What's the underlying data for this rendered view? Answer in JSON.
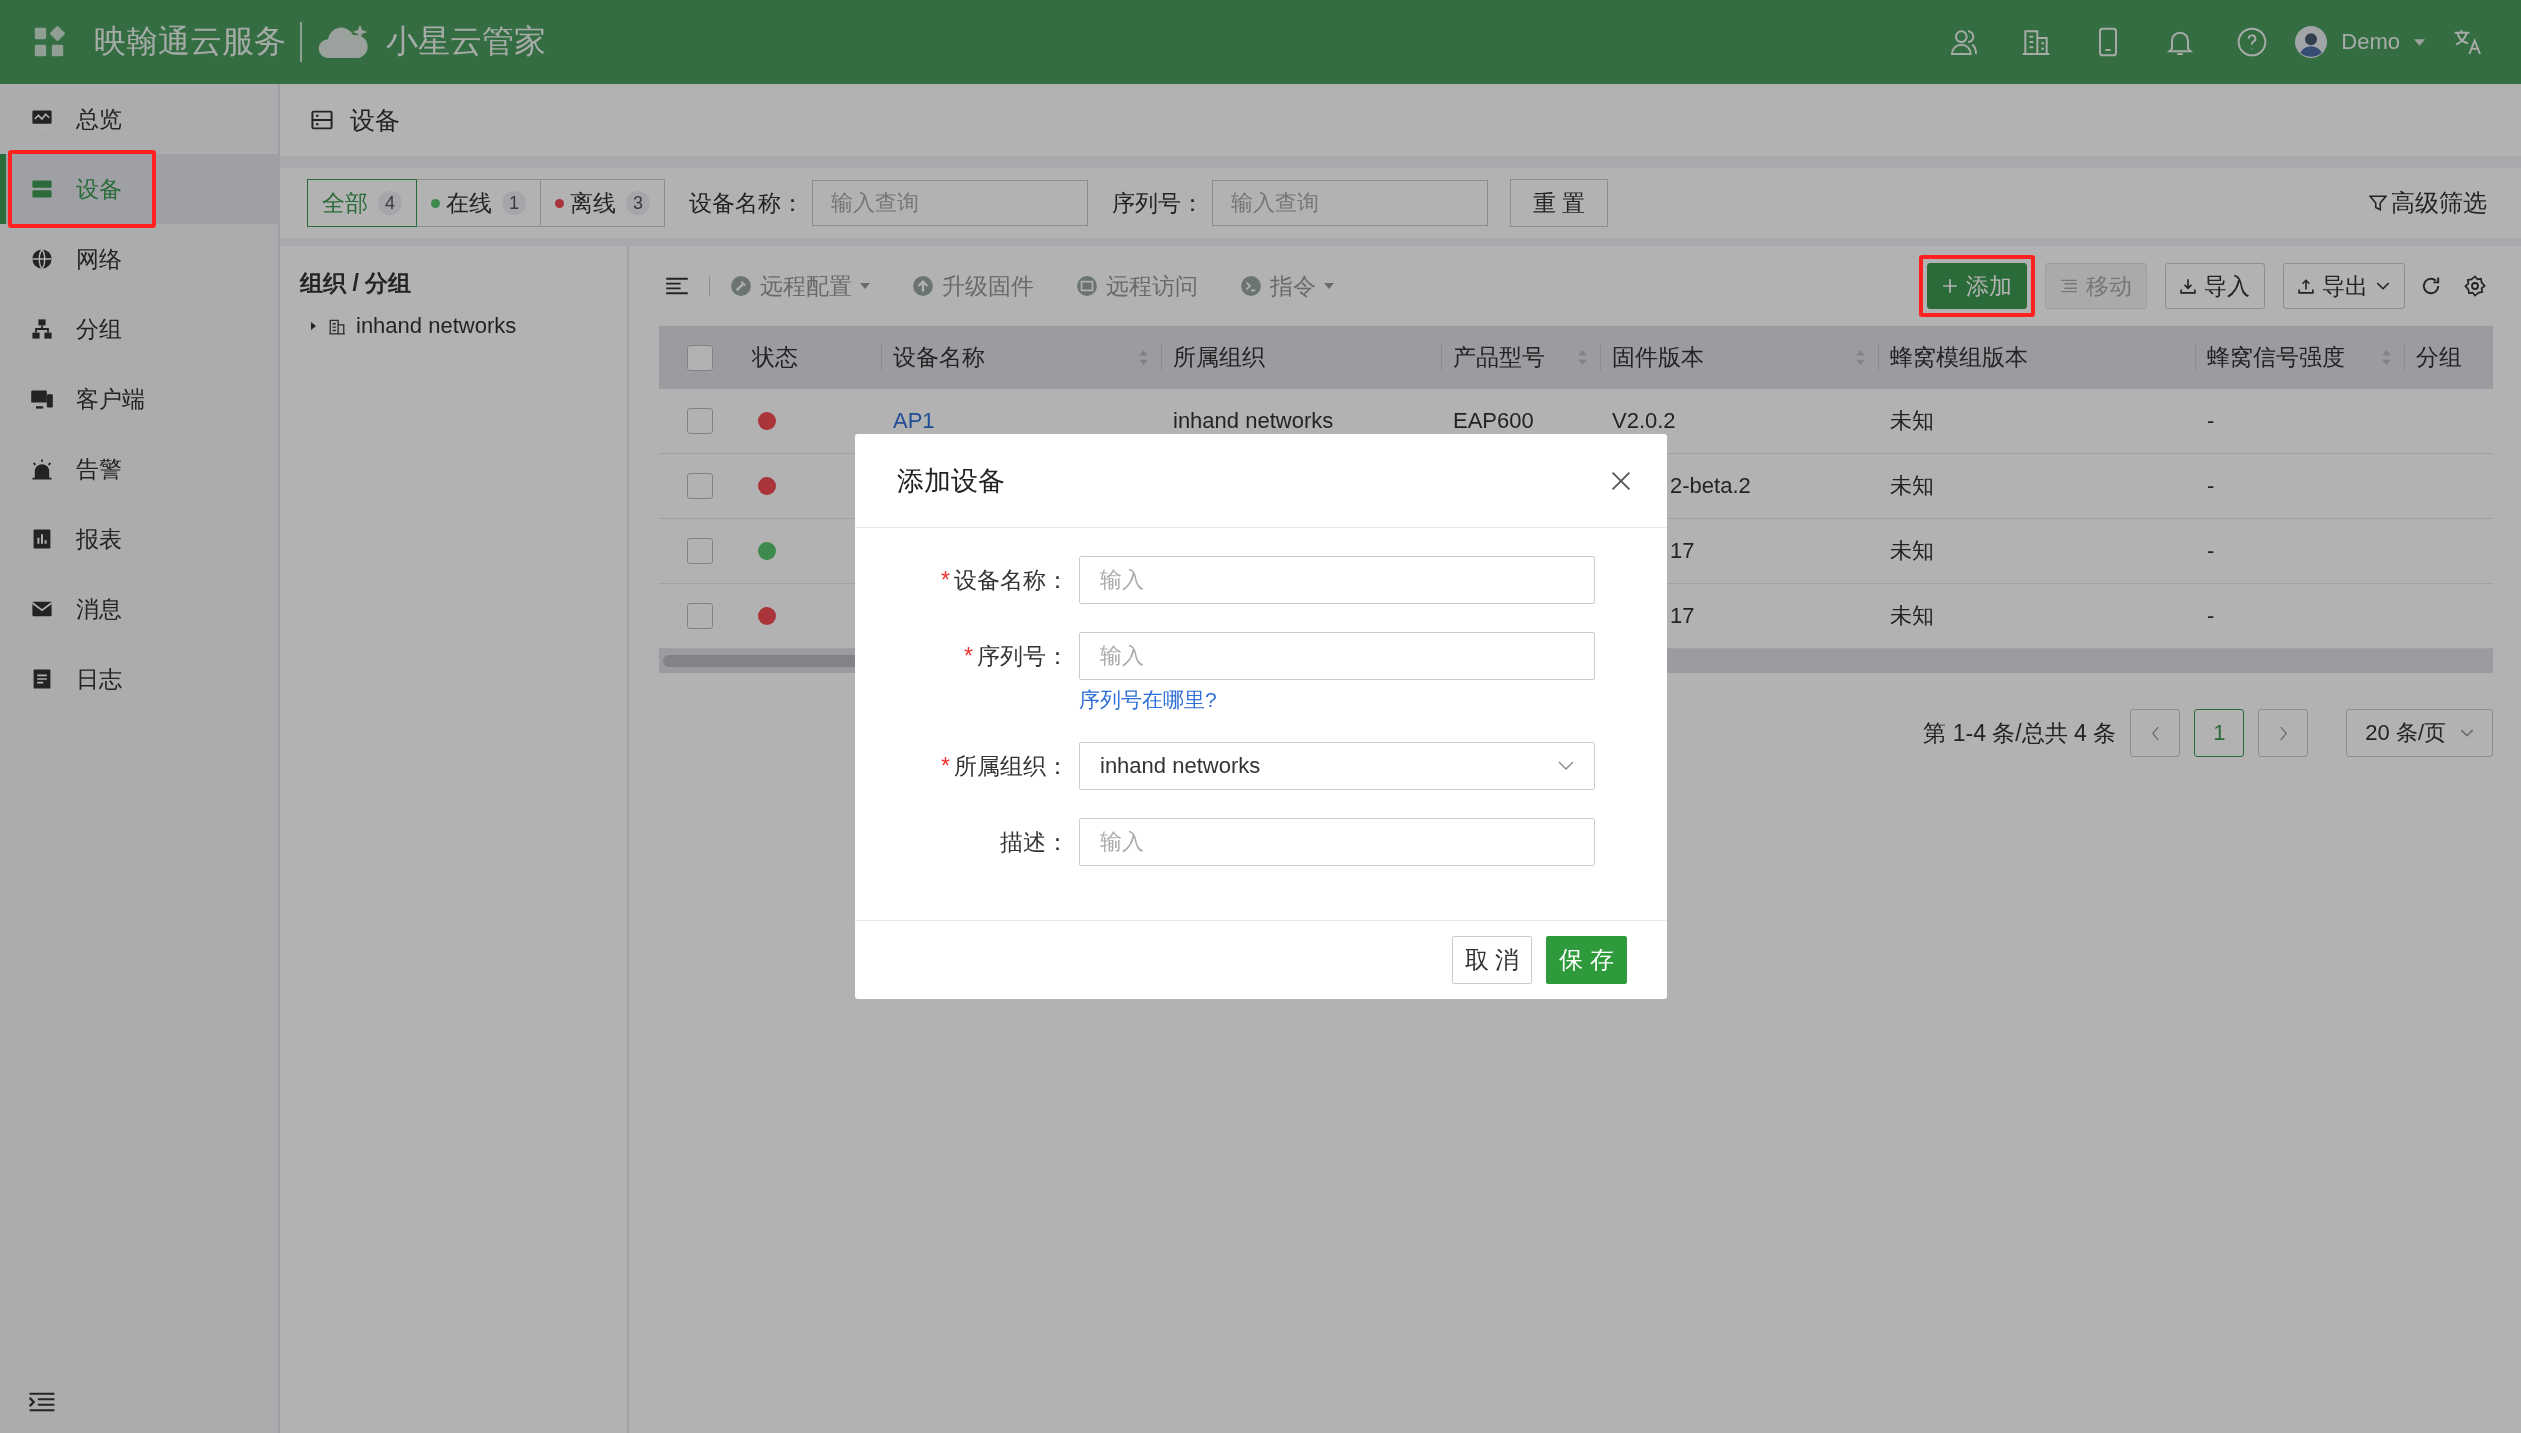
{
  "header": {
    "brand": "映翰通云服务",
    "product": "小星云管家",
    "user": "Demo"
  },
  "sidebar": {
    "items": [
      {
        "label": "总览",
        "kind": "overview",
        "selected": false,
        "highlighted": false
      },
      {
        "label": "设备",
        "kind": "device",
        "selected": true,
        "highlighted": true
      },
      {
        "label": "网络",
        "kind": "network",
        "selected": false,
        "highlighted": false
      },
      {
        "label": "分组",
        "kind": "group",
        "selected": false,
        "highlighted": false
      },
      {
        "label": "客户端",
        "kind": "client",
        "selected": false,
        "highlighted": false
      },
      {
        "label": "告警",
        "kind": "alarm",
        "selected": false,
        "highlighted": false
      },
      {
        "label": "报表",
        "kind": "report",
        "selected": false,
        "highlighted": false
      },
      {
        "label": "消息",
        "kind": "message",
        "selected": false,
        "highlighted": false
      },
      {
        "label": "日志",
        "kind": "log",
        "selected": false,
        "highlighted": false
      }
    ]
  },
  "page_title": "设备",
  "filters": {
    "tabs": [
      {
        "label": "全部",
        "count": "4",
        "selected": true
      },
      {
        "label": "在线",
        "count": "1",
        "selected": false,
        "color": "#3e8a4e"
      },
      {
        "label": "离线",
        "count": "3",
        "selected": false,
        "color": "#a9343a"
      }
    ],
    "fields": [
      {
        "label": "设备名称：",
        "placeholder": "输入查询"
      },
      {
        "label": "序列号：",
        "placeholder": "输入查询"
      }
    ],
    "reset": "重 置",
    "advanced": "高级筛选"
  },
  "tree": {
    "title": "组织 / 分组",
    "items": [
      {
        "label": "inhand networks",
        "expanded": false
      }
    ]
  },
  "toolbar": {
    "actions": [
      {
        "label": "远程配置",
        "kind": "config",
        "dropdown": true,
        "disabled": true
      },
      {
        "label": "升级固件",
        "kind": "upgrade",
        "dropdown": false,
        "disabled": true
      },
      {
        "label": "远程访问",
        "kind": "access",
        "dropdown": false,
        "disabled": true
      },
      {
        "label": "指令",
        "kind": "command",
        "dropdown": true,
        "disabled": true
      }
    ],
    "buttons": [
      {
        "label": "添加",
        "kind": "add",
        "disabled": false,
        "highlighted": true
      },
      {
        "label": "移动",
        "kind": "move",
        "disabled": true,
        "highlighted": false
      },
      {
        "label": "导入",
        "kind": "import",
        "disabled": false,
        "highlighted": false
      },
      {
        "label": "导出",
        "kind": "export",
        "disabled": false,
        "highlighted": false
      }
    ]
  },
  "table": {
    "select_all_checked": false,
    "columns": [
      {
        "label": "状态",
        "sortable": false
      },
      {
        "label": "设备名称",
        "sortable": true
      },
      {
        "label": "所属组织",
        "sortable": false
      },
      {
        "label": "产品型号",
        "sortable": true
      },
      {
        "label": "固件版本",
        "sortable": true
      },
      {
        "label": "蜂窝模组版本",
        "sortable": false
      },
      {
        "label": "蜂窝信号强度",
        "sortable": true
      },
      {
        "label": "分组",
        "sortable": false
      }
    ],
    "rows": [
      {
        "checked": false,
        "color": "#a9343a",
        "name": "AP1",
        "org": "inhand networks",
        "model": "EAP600",
        "firmware": "V2.0.2",
        "firmware_clipped": false,
        "module": "未知",
        "signal": "-"
      },
      {
        "checked": false,
        "color": "#a9343a",
        "firmware": "2-beta.2",
        "firmware_clipped": true,
        "module": "未知",
        "signal": "-"
      },
      {
        "checked": false,
        "color": "#3e8a4e",
        "firmware": "17",
        "firmware_clipped": true,
        "module": "未知",
        "signal": "-"
      },
      {
        "checked": false,
        "color": "#a9343a",
        "firmware": "17",
        "firmware_clipped": true,
        "module": "未知",
        "signal": "-"
      }
    ]
  },
  "pagination": {
    "summary": "第 1-4 条/总共 4 条",
    "pages": [
      {
        "label": "1",
        "selected": true
      }
    ],
    "page_size": "20 条/页"
  },
  "modal": {
    "title": "添加设备",
    "fields": [
      {
        "required_mark": "*",
        "label": "设备名称：",
        "kind": "input",
        "placeholder": "输入"
      },
      {
        "required_mark": "*",
        "label": "序列号：",
        "kind": "input",
        "placeholder": "输入",
        "help_link": "序列号在哪里?"
      },
      {
        "required_mark": "*",
        "label": "所属组织：",
        "kind": "select",
        "value": "inhand networks"
      },
      {
        "label": "描述：",
        "kind": "input",
        "placeholder": "输入"
      }
    ],
    "buttons": [
      {
        "label": "取 消",
        "kind": "default"
      },
      {
        "label": "保 存",
        "kind": "primary"
      }
    ]
  }
}
